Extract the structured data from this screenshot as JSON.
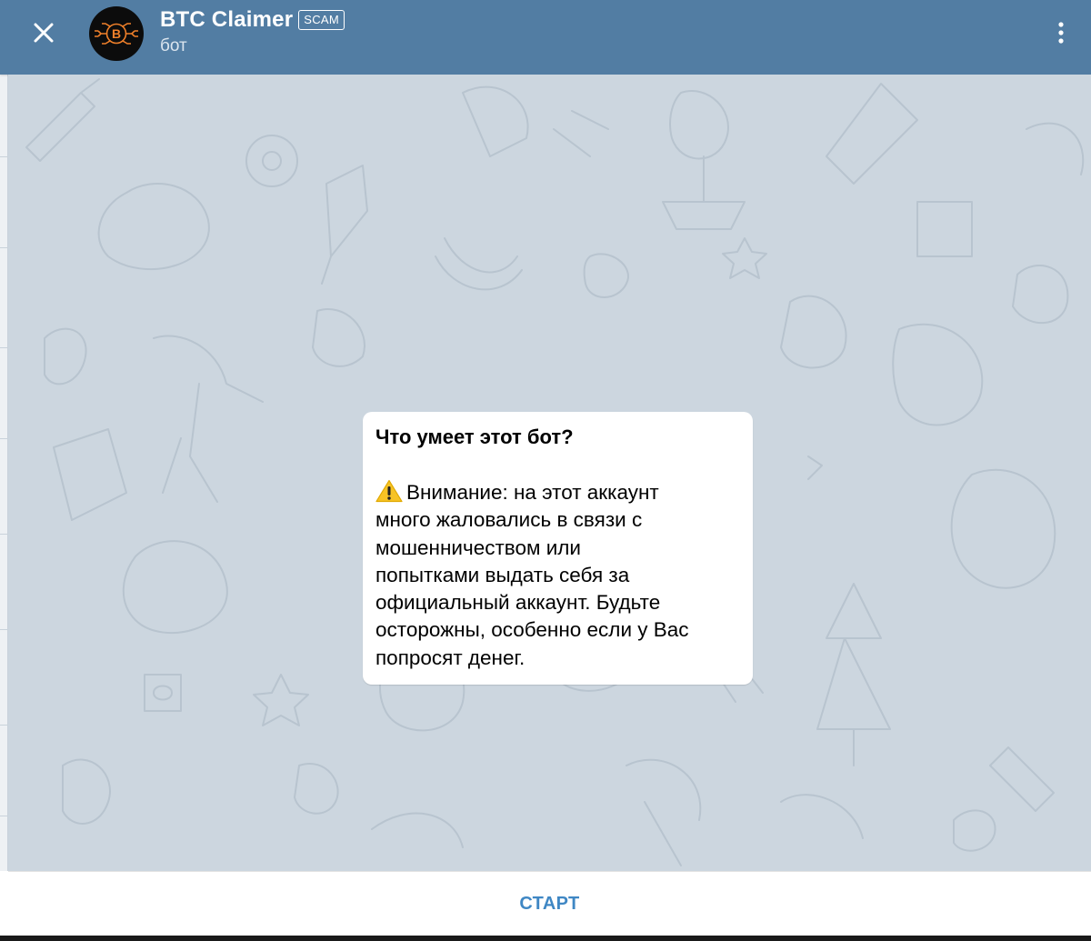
{
  "header": {
    "title": "BTC Claimer",
    "badge": "SCAM",
    "subtitle": "бот",
    "avatar_letter": "B",
    "avatar_accent": "#f0802a",
    "background": "#527da3",
    "icons": {
      "close": "close-icon",
      "menu": "more-vert-icon"
    }
  },
  "chat": {
    "background": "#ccd6df",
    "intro": {
      "title": "Что умеет этот бот?",
      "warning_icon": "warning-icon",
      "lines": [
        "Внимание: на этот аккаунт",
        "много жаловались в связи с",
        "мошенничеством или",
        "попытками выдать себя за",
        "официальный аккаунт. Будьте",
        "осторожны, особенно если у Вас",
        "попросят денег."
      ]
    }
  },
  "bottom": {
    "start_label": "СТАРТ",
    "accent": "#3f87c4"
  }
}
